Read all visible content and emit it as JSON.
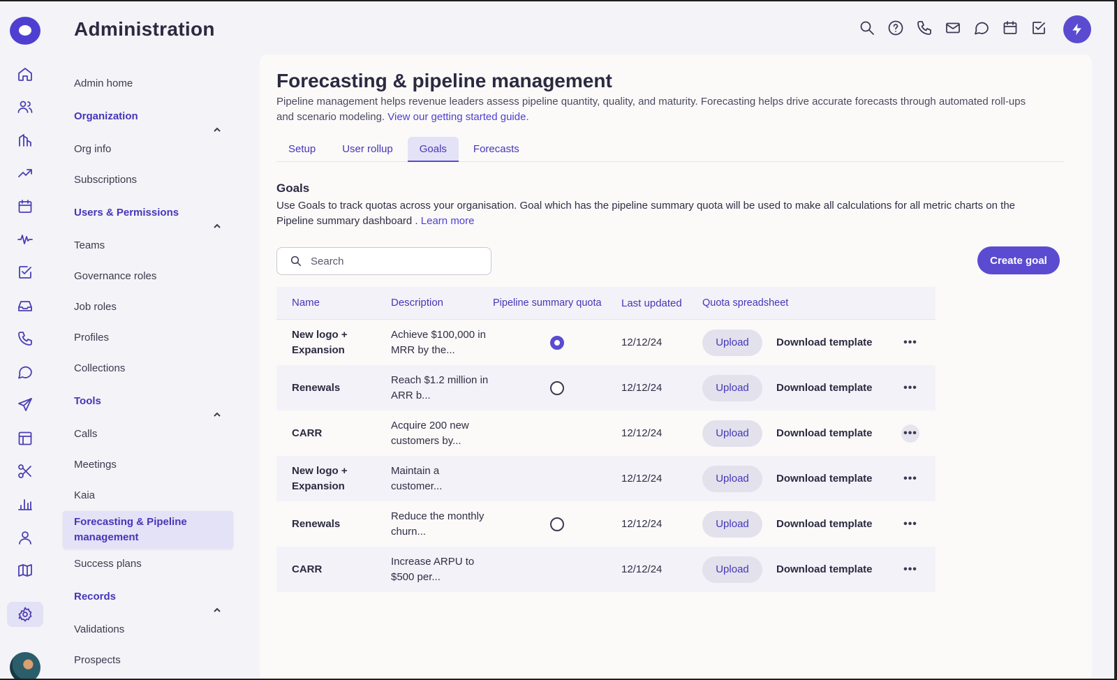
{
  "app": {
    "title": "Administration"
  },
  "rail_icons": [
    "home-icon",
    "contacts-icon",
    "accounts-icon",
    "trending-icon",
    "calendar-icon",
    "activity-icon",
    "tasks-icon",
    "inbox-icon",
    "phone-icon",
    "chat-icon",
    "send-icon",
    "layout-icon",
    "scissors-icon",
    "bar-chart-icon",
    "person-icon",
    "map-icon",
    "settings-icon"
  ],
  "top_icons": [
    "search-icon",
    "help-icon",
    "phone-icon",
    "mail-icon",
    "chat-icon",
    "calendar-icon",
    "tasks-icon",
    "bolt-icon"
  ],
  "nav": {
    "admin_home": "Admin home",
    "org_section": "Organization",
    "org_info": "Org info",
    "subscriptions": "Subscriptions",
    "users_section": "Users & Permissions",
    "teams": "Teams",
    "governance": "Governance roles",
    "job_roles": "Job roles",
    "profiles": "Profiles",
    "collections": "Collections",
    "tools_section": "Tools",
    "calls": "Calls",
    "meetings": "Meetings",
    "kaia": "Kaia",
    "forecasting": "Forecasting & Pipeline management",
    "success_plans": "Success plans",
    "records_section": "Records",
    "validations": "Validations",
    "prospects": "Prospects"
  },
  "page": {
    "title": "Forecasting & pipeline management",
    "intro": "Pipeline management helps revenue leaders assess pipeline quantity, quality, and maturity. Forecasting helps drive accurate forecasts through automated roll-ups and scenario modeling. ",
    "intro_link": "View our getting started guide."
  },
  "tabs": [
    "Setup",
    "User rollup",
    "Goals",
    "Forecasts"
  ],
  "active_tab": "Goals",
  "goals": {
    "title": "Goals",
    "desc": "Use Goals to track quotas across your organisation. Goal which has the pipeline summary quota  will be used to make all calculations for all metric charts on the Pipeline summary dashboard . ",
    "learn_more": "Learn more",
    "search_placeholder": "Search",
    "create_label": "Create goal"
  },
  "table": {
    "headers": [
      "Name",
      "Description",
      "Pipeline summary quota",
      "Last updated",
      "Quota spreadsheet"
    ],
    "upload_label": "Upload",
    "download_label": "Download template",
    "more_label": "•••",
    "rows": [
      {
        "name": "New logo + Expansion",
        "desc": "Achieve $100,000 in MRR by the...",
        "quota": "selected",
        "date": "12/12/24"
      },
      {
        "name": "Renewals",
        "desc": "Reach $1.2 million in ARR b...",
        "quota": "unselected",
        "date": "12/12/24"
      },
      {
        "name": "CARR",
        "desc": "Acquire 200 new customers by...",
        "quota": "none",
        "date": "12/12/24"
      },
      {
        "name": "New logo + Expansion",
        "desc": "Maintain a customer...",
        "quota": "none",
        "date": "12/12/24"
      },
      {
        "name": "Renewals",
        "desc": "Reduce the monthly churn...",
        "quota": "unselected",
        "date": "12/12/24"
      },
      {
        "name": "CARR",
        "desc": "Increase ARPU to $500 per...",
        "quota": "none",
        "date": "12/12/24"
      }
    ]
  },
  "colors": {
    "accent": "#5a4bd1",
    "link": "#4f40d0",
    "background": "#f4f3f7",
    "card": "#fbfaf9"
  }
}
